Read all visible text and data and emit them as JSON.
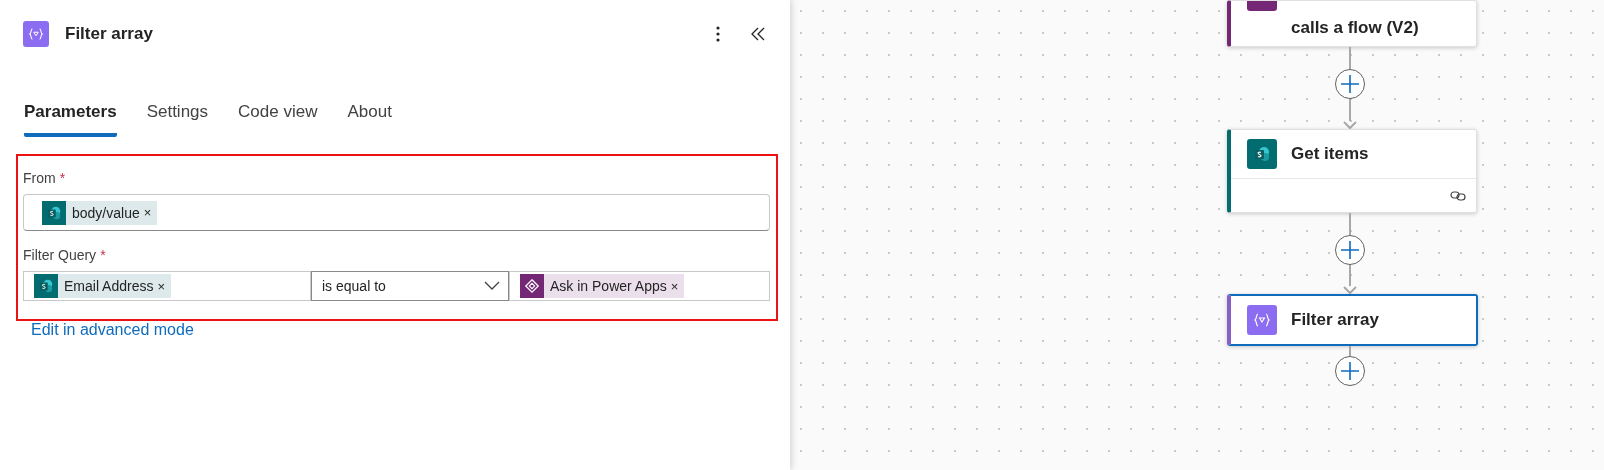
{
  "panel": {
    "title": "Filter array",
    "tabs": [
      {
        "label": "Parameters",
        "selected": true
      },
      {
        "label": "Settings",
        "selected": false
      },
      {
        "label": "Code view",
        "selected": false
      },
      {
        "label": "About",
        "selected": false
      }
    ],
    "highlighted": true,
    "fields": [
      {
        "kind": "tokens",
        "label": "From",
        "required_mark": "*",
        "tokens": [
          {
            "text": "body/value",
            "close": "×",
            "kind": "sharepoint"
          }
        ]
      },
      {
        "kind": "condition",
        "label": "Filter Query",
        "required_mark": "*",
        "left": {
          "text": "Email Address",
          "close": "×",
          "kind": "sharepoint"
        },
        "operator": "is equal to",
        "right": {
          "text": "Ask in Power Apps",
          "close": "×",
          "kind": "powerapps"
        }
      }
    ],
    "advanced_link": "Edit in advanced mode"
  },
  "canvas": {
    "nodes": [
      {
        "kind": "powerapps",
        "title": "calls a flow (V2)",
        "selected": false,
        "connection": false,
        "cut_top": true
      },
      {
        "kind": "sharepoint",
        "title": "Get items",
        "selected": false,
        "connection": true,
        "cut_top": false
      },
      {
        "kind": "filter",
        "title": "Filter array",
        "selected": true,
        "connection": false,
        "cut_top": false
      }
    ]
  }
}
